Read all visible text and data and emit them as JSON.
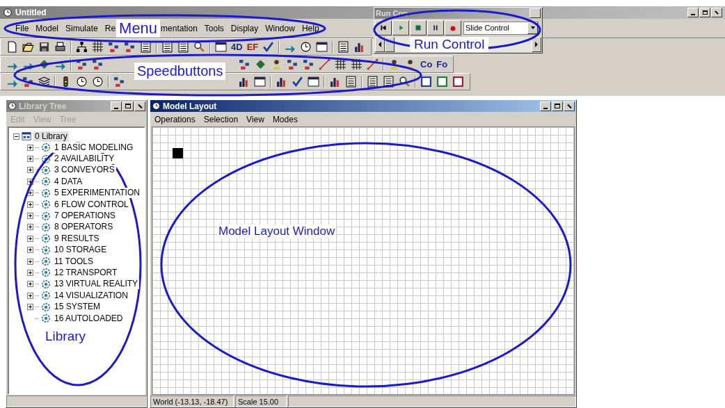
{
  "window": {
    "title": "Untitled"
  },
  "menu": [
    {
      "label": "File"
    },
    {
      "label": "Model"
    },
    {
      "label": "Simulate"
    },
    {
      "label": "Re"
    },
    {
      "label": "mentation"
    },
    {
      "label": "Tools"
    },
    {
      "label": "Display"
    },
    {
      "label": "Window"
    },
    {
      "label": "Help"
    }
  ],
  "toolbar_texts": {
    "row1": [
      "4D",
      "EF"
    ],
    "row2": [
      "Co",
      "Fo"
    ]
  },
  "run_control": {
    "title": "Run Con",
    "mode": "Slide Control"
  },
  "annotations": {
    "menu": "Menu",
    "speedbuttons": "Speedbuttons",
    "run_control": "Run Control",
    "library": "Library",
    "model_layout": "Model Layout Window"
  },
  "library_tree": {
    "title": "Library Tree",
    "active": false,
    "menu": [
      {
        "label": "Edit",
        "disabled": true
      },
      {
        "label": "View",
        "disabled": true
      },
      {
        "label": "Tree",
        "disabled": true
      }
    ],
    "root": {
      "label": "0 Library",
      "expanded": true,
      "selected": true,
      "children": [
        {
          "label": "1 BASIC MODELING",
          "kind": "branch",
          "expanded": false,
          "selected": false
        },
        {
          "label": "2 AVAILABILITY",
          "kind": "branch",
          "expanded": false,
          "selected": false
        },
        {
          "label": "3 CONVEYORS",
          "kind": "branch",
          "expanded": false,
          "selected": false
        },
        {
          "label": "4 DATA",
          "kind": "branch",
          "expanded": false,
          "selected": false
        },
        {
          "label": "5 EXPERIMENTATION",
          "kind": "branch",
          "expanded": false,
          "selected": false
        },
        {
          "label": "6 FLOW CONTROL",
          "kind": "branch",
          "expanded": false,
          "selected": false
        },
        {
          "label": "7 OPERATIONS",
          "kind": "branch",
          "expanded": false,
          "selected": false
        },
        {
          "label": "8 OPERATORS",
          "kind": "branch",
          "expanded": false,
          "selected": false
        },
        {
          "label": "9 RESULTS",
          "kind": "branch",
          "expanded": false,
          "selected": false
        },
        {
          "label": "10 STORAGE",
          "kind": "branch",
          "expanded": false,
          "selected": false
        },
        {
          "label": "11 TOOLS",
          "kind": "branch",
          "expanded": false,
          "selected": false
        },
        {
          "label": "12 TRANSPORT",
          "kind": "branch",
          "expanded": false,
          "selected": false
        },
        {
          "label": "13 VIRTUAL REALITY",
          "kind": "branch",
          "expanded": false,
          "selected": false
        },
        {
          "label": "14 VISUALIZATION",
          "kind": "branch",
          "expanded": false,
          "selected": false
        },
        {
          "label": "15 SYSTEM",
          "kind": "branch",
          "expanded": false,
          "selected": false
        },
        {
          "label": "16 AUTOLOADED",
          "kind": "leaf",
          "selected": false
        }
      ]
    }
  },
  "model_layout": {
    "title": "Model Layout",
    "active": true,
    "menu": [
      {
        "label": "Operations",
        "disabled": false
      },
      {
        "label": "Selection",
        "disabled": false
      },
      {
        "label": "View",
        "disabled": false
      },
      {
        "label": "Modes",
        "disabled": false
      }
    ],
    "status": [
      "World (-13.13, -18.47)",
      "Scale 15.00"
    ]
  }
}
